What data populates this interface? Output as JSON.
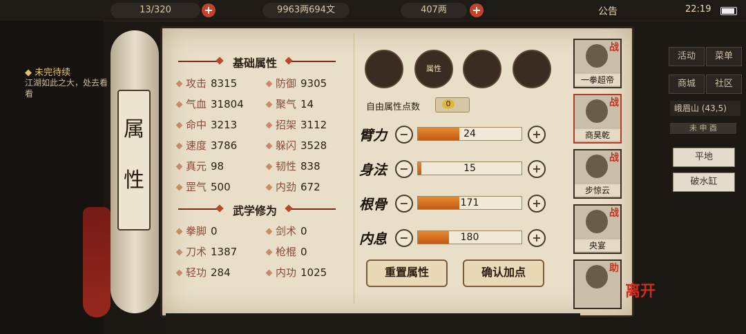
{
  "topbar": {
    "stamina": "13/320",
    "money": "9963两694文",
    "silver": "407两",
    "notice": "公告",
    "clock": "22:19"
  },
  "quest": {
    "title": "未完待续",
    "text": "江湖如此之大，处去看看"
  },
  "scroll_label": [
    "属",
    "性"
  ],
  "basic": {
    "title": "基础属性",
    "stats": [
      {
        "label": "攻击",
        "value": "8315"
      },
      {
        "label": "防御",
        "value": "9305"
      },
      {
        "label": "气血",
        "value": "31804"
      },
      {
        "label": "聚气",
        "value": "14"
      },
      {
        "label": "命中",
        "value": "3213"
      },
      {
        "label": "招架",
        "value": "3112"
      },
      {
        "label": "速度",
        "value": "3786"
      },
      {
        "label": "躲闪",
        "value": "3528"
      },
      {
        "label": "真元",
        "value": "98"
      },
      {
        "label": "韧性",
        "value": "838"
      },
      {
        "label": "罡气",
        "value": "500"
      },
      {
        "label": "内劲",
        "value": "672"
      }
    ]
  },
  "martial": {
    "title": "武学修为",
    "stats": [
      {
        "label": "拳脚",
        "value": "0"
      },
      {
        "label": "剑术",
        "value": "0"
      },
      {
        "label": "刀术",
        "value": "1387"
      },
      {
        "label": "枪棍",
        "value": "0"
      },
      {
        "label": "轻功",
        "value": "284"
      },
      {
        "label": "内功",
        "value": "1025"
      }
    ]
  },
  "tab_icons": [
    {
      "name": "character-icon",
      "label": ""
    },
    {
      "name": "attributes-scroll-icon",
      "label": "属性"
    },
    {
      "name": "bagua-icon",
      "label": ""
    },
    {
      "name": "meridian-icon",
      "label": ""
    }
  ],
  "free_points": {
    "label": "自由属性点数",
    "value": "0"
  },
  "attributes": [
    {
      "name": "臂力",
      "value": "24",
      "fill": 0.4
    },
    {
      "name": "身法",
      "value": "15",
      "fill": 0.03
    },
    {
      "name": "根骨",
      "value": "171",
      "fill": 0.4
    },
    {
      "name": "内息",
      "value": "180",
      "fill": 0.3
    }
  ],
  "buttons": {
    "reset": "重置属性",
    "confirm": "确认加点"
  },
  "party": [
    {
      "name": "一拳超帝",
      "tag": "战"
    },
    {
      "name": "商昊乾",
      "tag": "战"
    },
    {
      "name": "步惊云",
      "tag": "战"
    },
    {
      "name": "央宴",
      "tag": "战"
    },
    {
      "name": "",
      "tag": "助"
    }
  ],
  "right_menu": [
    "活动",
    "菜单",
    "商城",
    "社区"
  ],
  "location": {
    "name": "峨眉山",
    "coords": "(43,5)",
    "compass": "未 申 酉"
  },
  "terrain": [
    "平地",
    "破水缸"
  ],
  "leave": "离开"
}
